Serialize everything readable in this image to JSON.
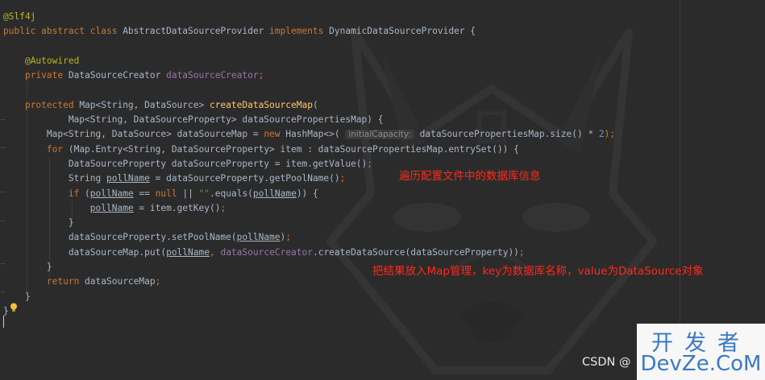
{
  "code": [
    {
      "segments": [
        {
          "t": "@Slf4j",
          "c": "ann"
        }
      ]
    },
    {
      "segments": [
        {
          "t": "public abstract class ",
          "c": "kw"
        },
        {
          "t": "AbstractDataSourceProvider "
        },
        {
          "t": "implements ",
          "c": "kw"
        },
        {
          "t": "DynamicDataSourceProvider {"
        }
      ]
    },
    {
      "segments": []
    },
    {
      "segments": [
        {
          "t": "    "
        },
        {
          "t": "@Autowired",
          "c": "ann"
        }
      ]
    },
    {
      "segments": [
        {
          "t": "    "
        },
        {
          "t": "private ",
          "c": "kw"
        },
        {
          "t": "DataSourceCreator "
        },
        {
          "t": "dataSourceCreator",
          "c": "fld"
        },
        {
          "t": ";",
          "c": "kw"
        }
      ]
    },
    {
      "segments": []
    },
    {
      "segments": [
        {
          "t": "    "
        },
        {
          "t": "protected ",
          "c": "kw"
        },
        {
          "t": "Map<String, DataSource> "
        },
        {
          "t": "createDataSourceMap",
          "c": "fn"
        },
        {
          "t": "("
        }
      ]
    },
    {
      "segments": [
        {
          "t": "            Map<String, DataSourceProperty> dataSourcePropertiesMap) {"
        }
      ]
    },
    {
      "segments": [
        {
          "t": "        Map<String, DataSource> dataSourceMap = "
        },
        {
          "t": "new ",
          "c": "kw"
        },
        {
          "t": "HashMap<>( "
        },
        {
          "t": "initialCapacity:",
          "c": "hint"
        },
        {
          "t": " dataSourcePropertiesMap.size() * "
        },
        {
          "t": "2",
          "c": "num"
        },
        {
          "t": ");",
          "c": "kw"
        }
      ]
    },
    {
      "segments": [
        {
          "t": "        "
        },
        {
          "t": "for ",
          "c": "kw"
        },
        {
          "t": "(Map.Entry<String, DataSourceProperty> item : dataSourcePropertiesMap.entrySet()) {"
        }
      ]
    },
    {
      "segments": [
        {
          "t": "            DataSourceProperty dataSourceProperty = item.getValue()"
        },
        {
          "t": ";",
          "c": "kw"
        }
      ]
    },
    {
      "segments": [
        {
          "t": "            String "
        },
        {
          "t": "pollName",
          "c": "u"
        },
        {
          "t": " = dataSourceProperty.getPoolName()"
        },
        {
          "t": ";",
          "c": "kw"
        }
      ]
    },
    {
      "segments": [
        {
          "t": "            "
        },
        {
          "t": "if ",
          "c": "kw"
        },
        {
          "t": "("
        },
        {
          "t": "pollName",
          "c": "u"
        },
        {
          "t": " == "
        },
        {
          "t": "null ",
          "c": "kw"
        },
        {
          "t": "|| "
        },
        {
          "t": "\"\"",
          "c": "str"
        },
        {
          "t": ".equals("
        },
        {
          "t": "pollName",
          "c": "u"
        },
        {
          "t": ")) {"
        }
      ]
    },
    {
      "segments": [
        {
          "t": "                "
        },
        {
          "t": "pollName",
          "c": "u"
        },
        {
          "t": " = item.getKey()"
        },
        {
          "t": ";",
          "c": "kw"
        }
      ]
    },
    {
      "segments": [
        {
          "t": "            }"
        }
      ]
    },
    {
      "segments": [
        {
          "t": "            dataSourceProperty.setPoolName("
        },
        {
          "t": "pollName",
          "c": "u"
        },
        {
          "t": ")"
        },
        {
          "t": ";",
          "c": "kw"
        }
      ]
    },
    {
      "segments": [
        {
          "t": "            dataSourceMap.put("
        },
        {
          "t": "pollName",
          "c": "u"
        },
        {
          "t": ", ",
          "c": "kw"
        },
        {
          "t": "dataSourceCreator",
          "c": "fld"
        },
        {
          "t": ".createDataSource(dataSourceProperty))"
        },
        {
          "t": ";",
          "c": "kw"
        }
      ]
    },
    {
      "segments": [
        {
          "t": "        }"
        }
      ]
    },
    {
      "segments": [
        {
          "t": "        "
        },
        {
          "t": "return ",
          "c": "kw"
        },
        {
          "t": "dataSourceMap"
        },
        {
          "t": ";",
          "c": "kw"
        }
      ]
    },
    {
      "segments": [
        {
          "t": "    }"
        }
      ]
    },
    {
      "segments": [
        {
          "t": "}"
        }
      ]
    }
  ],
  "annotations": {
    "note1": "遍历配置文件中的数据库信息",
    "note2": "把结果放入Map管理，key为数据库名称，value为DataSource对象"
  },
  "watermark": {
    "logo_cn": "开发者",
    "logo_en": "DevZe.CoM",
    "csdn": "CSDN @"
  },
  "icons": {
    "bulb": "lightbulb-icon"
  },
  "colors": {
    "keyword": "#cc7832",
    "annotation": "#bbb529",
    "field": "#9876aa",
    "method": "#ffc66d",
    "string": "#6a8759",
    "background": "#2b2b2b",
    "note": "#ff2a1a"
  }
}
